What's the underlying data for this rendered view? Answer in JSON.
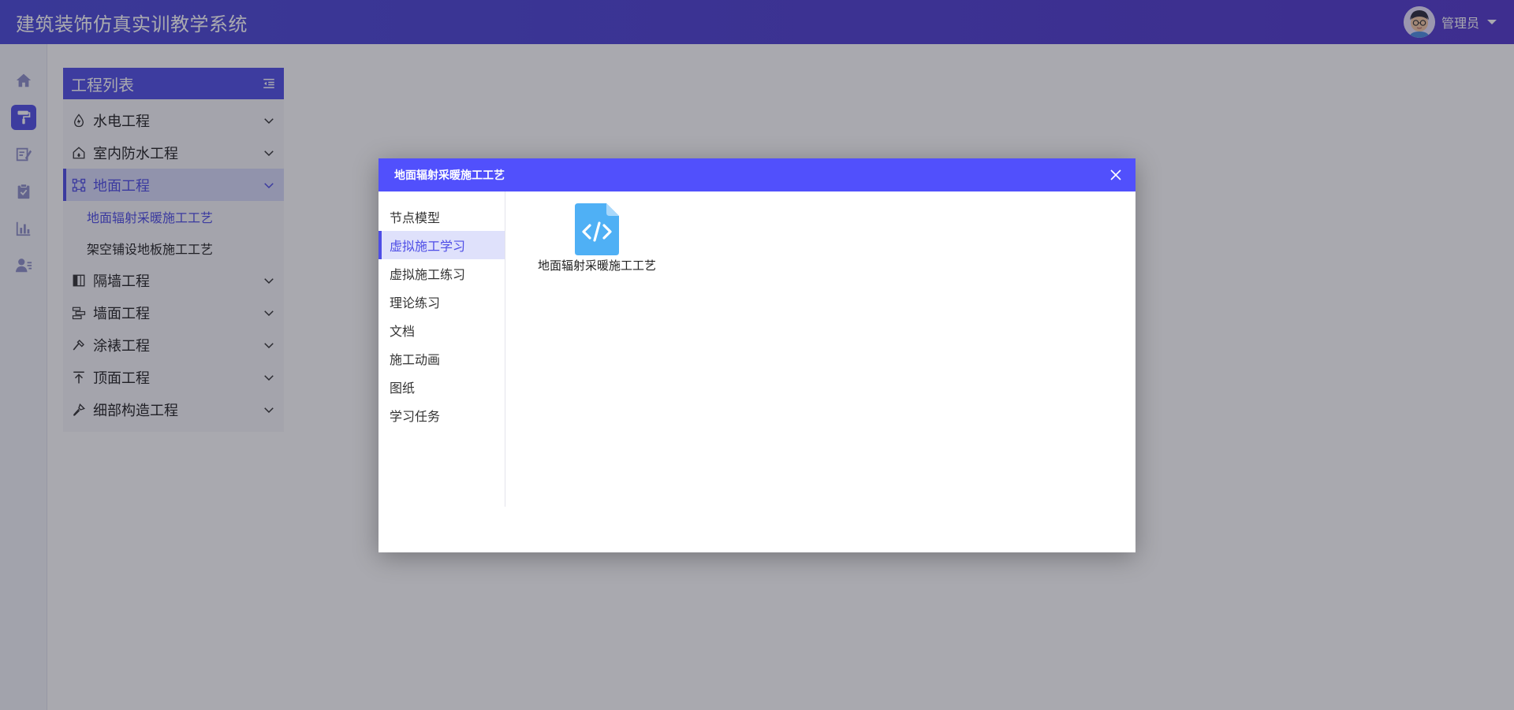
{
  "app": {
    "title": "建筑装饰仿真实训教学系统",
    "user_name": "管理员"
  },
  "rail": {
    "items": [
      {
        "icon": "home-icon",
        "active": false
      },
      {
        "icon": "paint-roller-icon",
        "active": true
      },
      {
        "icon": "edit-note-icon",
        "active": false
      },
      {
        "icon": "clipboard-icon",
        "active": false
      },
      {
        "icon": "bar-chart-icon",
        "active": false
      },
      {
        "icon": "user-list-icon",
        "active": false
      }
    ]
  },
  "project_panel": {
    "title": "工程列表",
    "items": [
      {
        "label": "水电工程",
        "icon": "water-drop-icon",
        "expanded": false
      },
      {
        "label": "室内防水工程",
        "icon": "house-icon",
        "expanded": false
      },
      {
        "label": "地面工程",
        "icon": "node-graph-icon",
        "expanded": true,
        "active": true,
        "children": [
          {
            "label": "地面辐射采暖施工工艺",
            "active": true
          },
          {
            "label": "架空铺设地板施工工艺",
            "active": false
          }
        ]
      },
      {
        "label": "隔墙工程",
        "icon": "partition-wall-icon",
        "expanded": false
      },
      {
        "label": "墙面工程",
        "icon": "wall-icon",
        "expanded": false
      },
      {
        "label": "涂裱工程",
        "icon": "hammer-icon",
        "expanded": false
      },
      {
        "label": "顶面工程",
        "icon": "arrow-up-ceiling-icon",
        "expanded": false
      },
      {
        "label": "细部构造工程",
        "icon": "brush-icon",
        "expanded": false
      }
    ]
  },
  "modal": {
    "title": "地面辐射采暖施工工艺",
    "tabs": [
      {
        "label": "节点模型",
        "active": false
      },
      {
        "label": "虚拟施工学习",
        "active": true
      },
      {
        "label": "虚拟施工练习",
        "active": false
      },
      {
        "label": "理论练习",
        "active": false
      },
      {
        "label": "文档",
        "active": false
      },
      {
        "label": "施工动画",
        "active": false
      },
      {
        "label": "图纸",
        "active": false
      },
      {
        "label": "学习任务",
        "active": false
      }
    ],
    "files": [
      {
        "name": "地面辐射采暖施工工艺",
        "icon": "code-file-icon"
      }
    ]
  },
  "colors": {
    "header": "#4b4ad8",
    "accent": "#5150e6",
    "modal_header": "#5150fc",
    "file_icon": "#4fb0f5"
  }
}
